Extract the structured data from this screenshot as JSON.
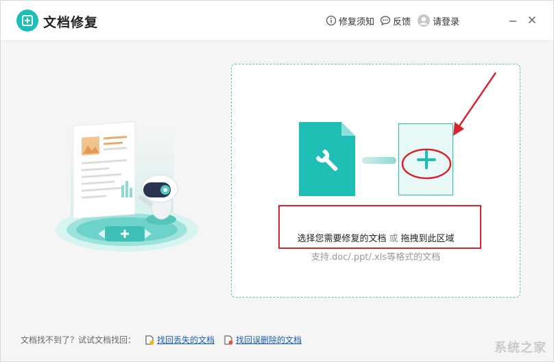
{
  "app": {
    "title": "文档修复"
  },
  "header": {
    "notice_label": "修复须知",
    "feedback_label": "反馈",
    "login_label": "请登录"
  },
  "dropzone": {
    "primary_select": "选择您需要修复的文档",
    "primary_or": "或",
    "primary_drag": "拖拽到此区域",
    "supported_formats": "支持.doc/.ppt/.xls等格式的文档"
  },
  "footer": {
    "prompt": "文档找不到了？试试文档找回：",
    "recover_lost_label": "找回丢失的文档",
    "recover_deleted_label": "找回误删除的文档"
  },
  "watermark": {
    "text": "系统之家"
  },
  "colors": {
    "accent": "#1bbfb8",
    "annotation_red": "#d9232c",
    "link": "#1a5fb4"
  }
}
